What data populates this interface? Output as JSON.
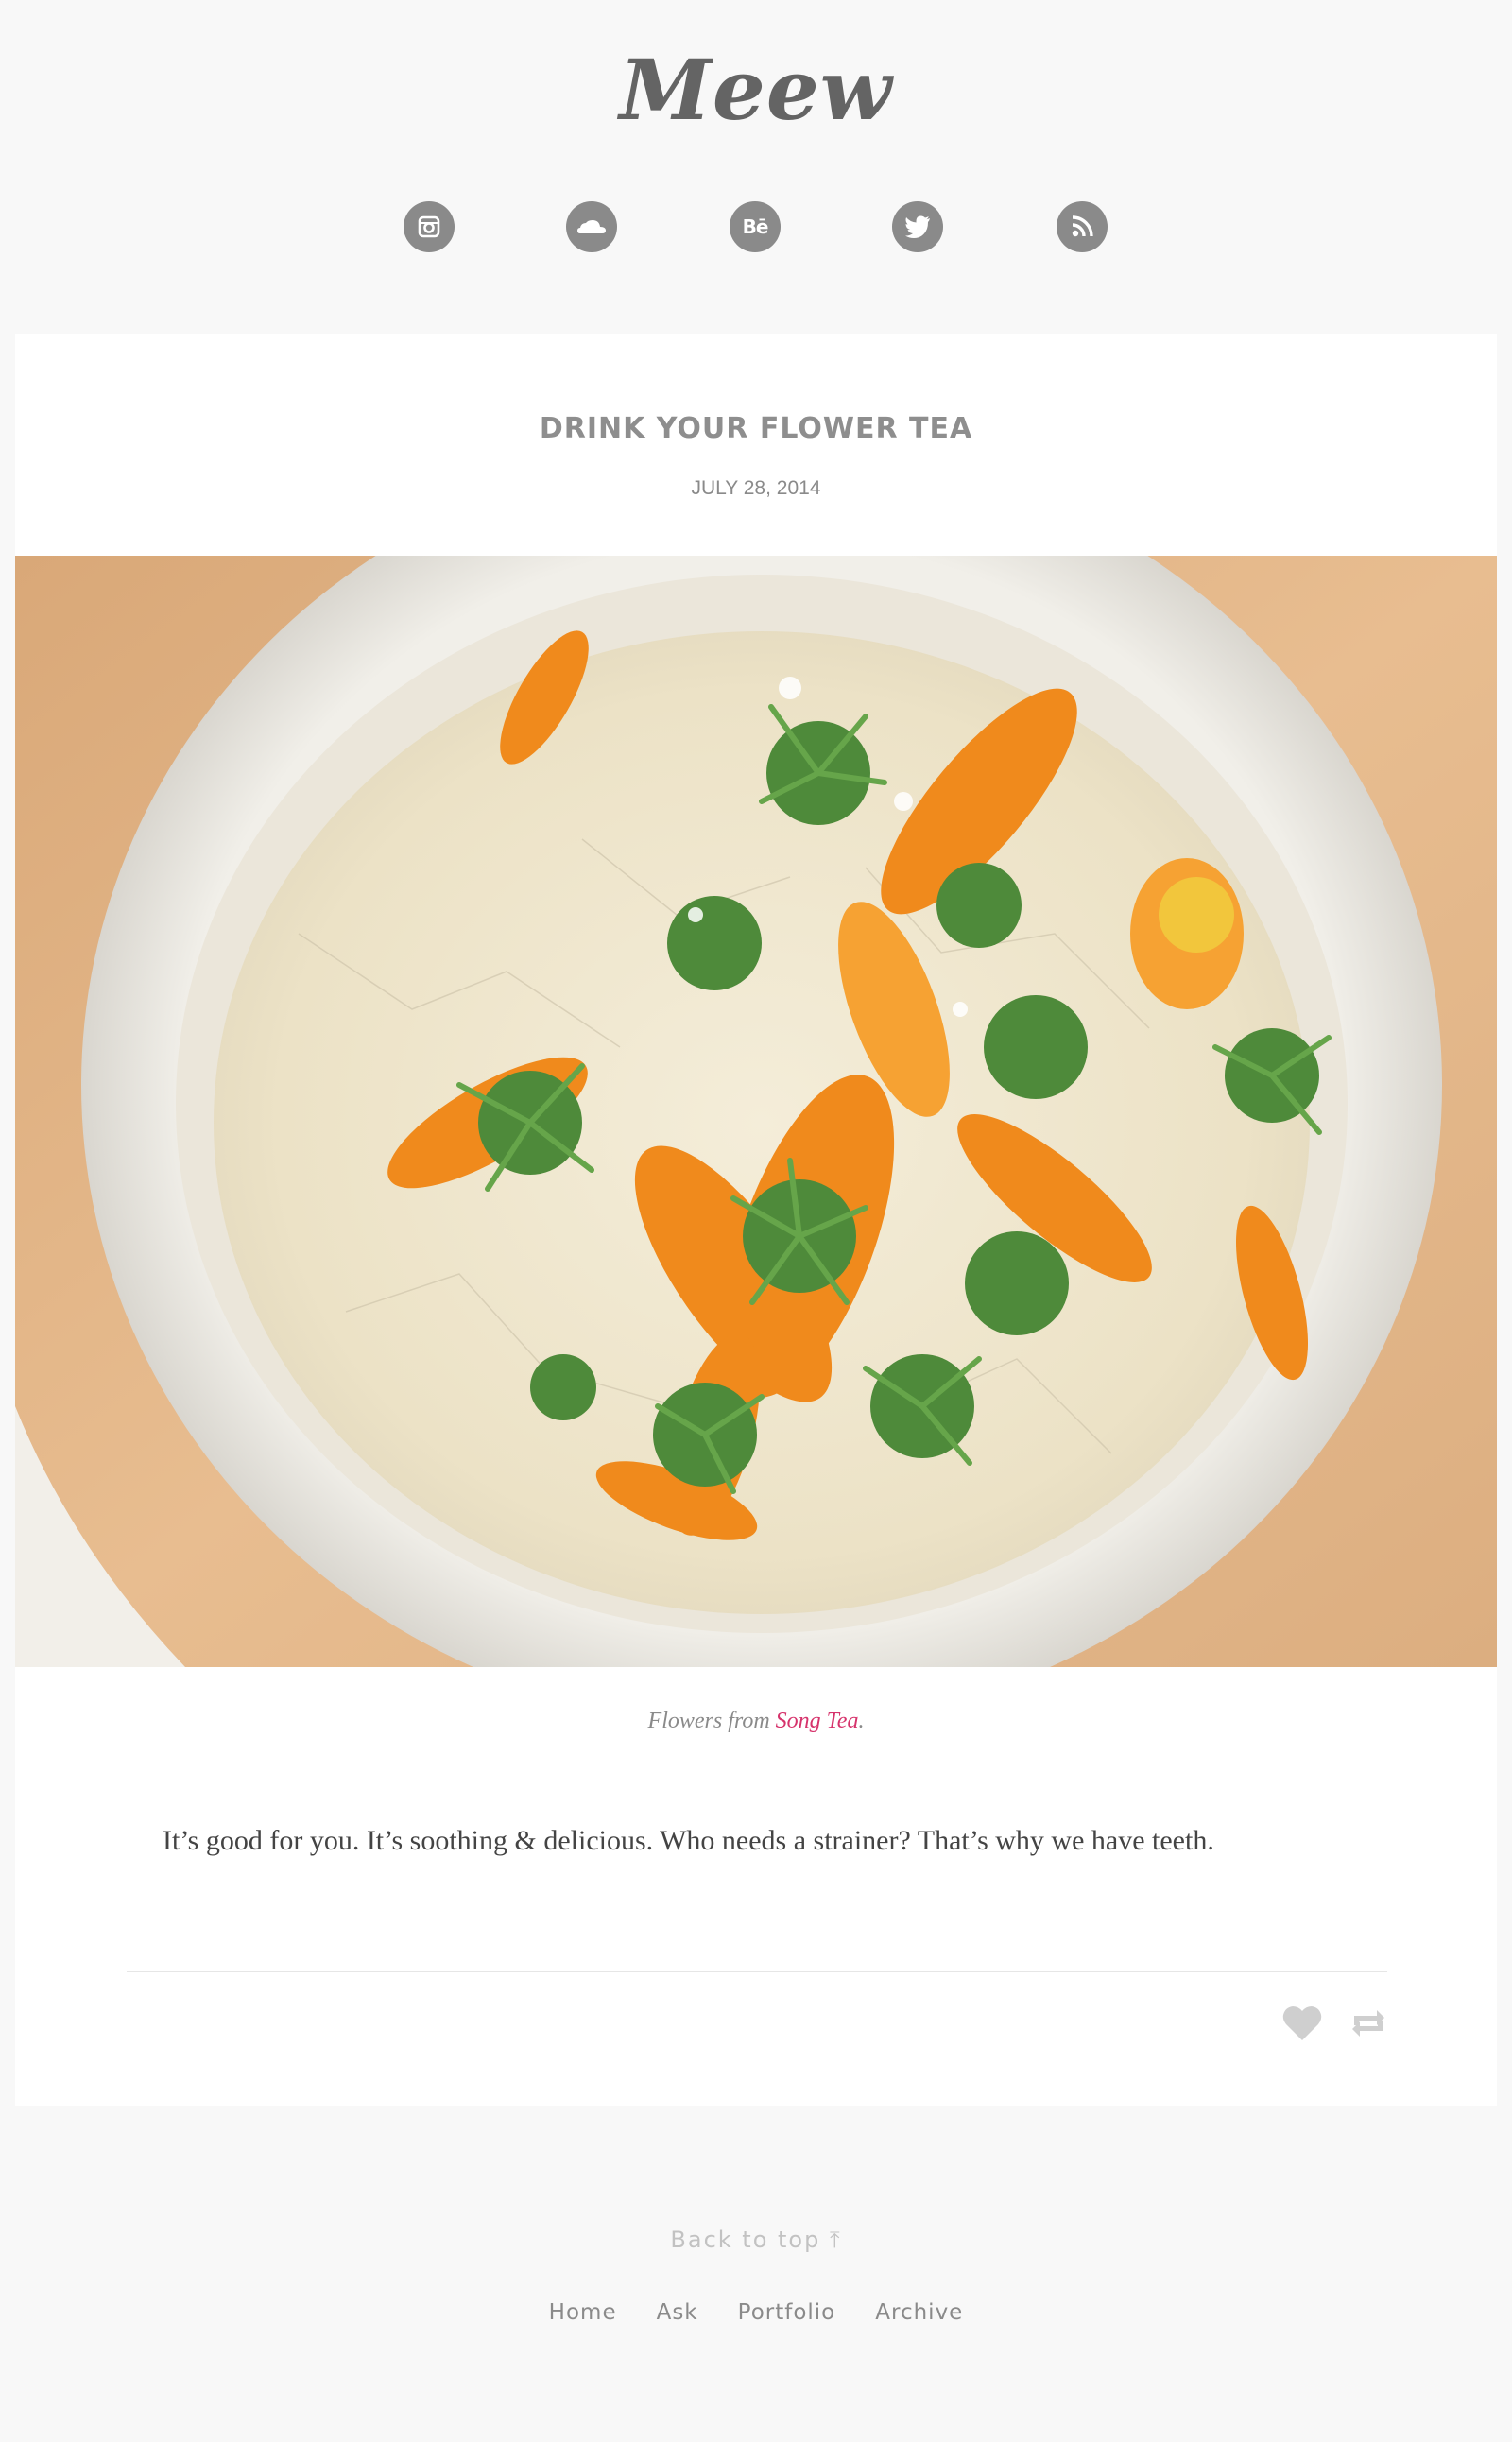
{
  "blog": {
    "title": "Meew"
  },
  "social": [
    {
      "icon": "instagram-icon"
    },
    {
      "icon": "soundcloud-icon"
    },
    {
      "icon": "behance-icon",
      "glyph": "Bē"
    },
    {
      "icon": "twitter-icon"
    },
    {
      "icon": "rss-icon"
    }
  ],
  "post": {
    "title": "DRINK YOUR FLOWER TEA",
    "date": "JULY 28, 2014",
    "photo_alt": "Flowers floating in a white bowl of tea",
    "caption_prefix": "Flowers from ",
    "caption_link": "Song Tea",
    "caption_suffix": ".",
    "body": "It’s good for you. It’s soothing & delicious. Who needs a strainer? That’s why we have teeth."
  },
  "actions": {
    "like_icon": "heart-icon",
    "reblog_icon": "reblog-icon"
  },
  "footer": {
    "back_to_top": "Back to top ⤒",
    "nav": [
      "Home",
      "Ask",
      "Portfolio",
      "Archive"
    ]
  },
  "colors": {
    "page_bg": "#f8f8f8",
    "card_bg": "#ffffff",
    "text_gray": "#8a8a8a",
    "link_pink": "#d6336c",
    "icon_gray": "#8a8a8a"
  }
}
